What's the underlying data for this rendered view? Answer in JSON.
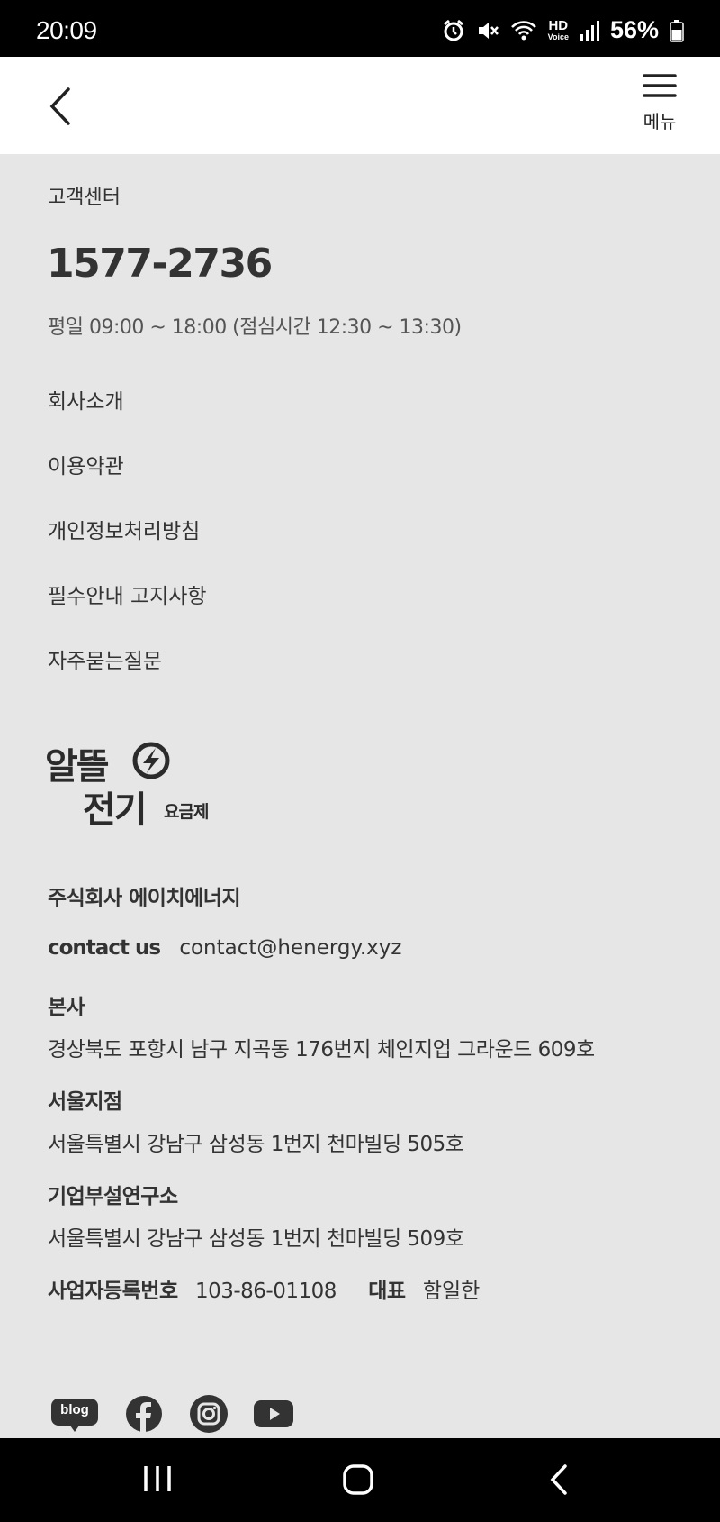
{
  "status_bar": {
    "time": "20:09",
    "hd_top": "HD",
    "hd_bottom": "Voice",
    "battery_percent": "56%"
  },
  "header": {
    "menu_label": "메뉴"
  },
  "customer_center": {
    "label": "고객센터",
    "phone": "1577-2736",
    "hours": "평일 09:00 ~ 18:00 (점심시간 12:30 ~ 13:30)"
  },
  "nav_links": [
    "회사소개",
    "이용약관",
    "개인정보처리방침",
    "필수안내 고지사항",
    "자주묻는질문"
  ],
  "logo": {
    "line1": "알뜰",
    "line2": "전기",
    "suffix": "요금제"
  },
  "company": {
    "name": "주식회사 에이치에너지",
    "contact_label": "contact us",
    "contact_email": "contact@henergy.xyz",
    "offices": [
      {
        "title": "본사",
        "address": "경상북도 포항시 남구 지곡동 176번지 체인지업 그라운드 609호"
      },
      {
        "title": "서울지점",
        "address": "서울특별시 강남구 삼성동 1번지 천마빌딩 505호"
      },
      {
        "title": "기업부설연구소",
        "address": "서울특별시 강남구 삼성동 1번지 천마빌딩 509호"
      }
    ],
    "biz_reg_label": "사업자등록번호",
    "biz_reg_number": "103-86-01108",
    "ceo_label": "대표",
    "ceo_name": "함일한"
  },
  "social": {
    "blog_label": "blog",
    "icons": [
      "blog-icon",
      "facebook-icon",
      "instagram-icon",
      "youtube-icon"
    ]
  },
  "colors": {
    "background": "#e6e6e6",
    "text": "#333333",
    "bars": "#000000"
  }
}
